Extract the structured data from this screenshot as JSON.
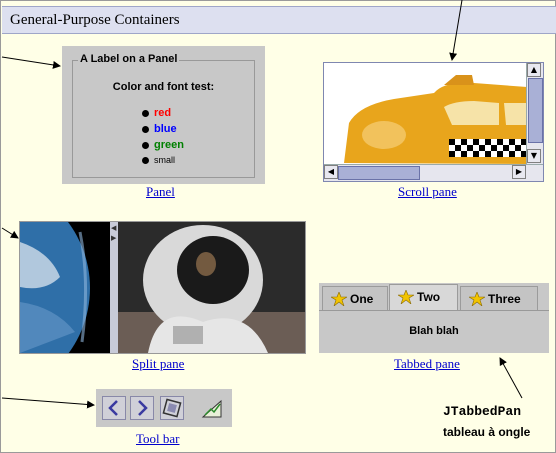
{
  "header": {
    "title": "General-Purpose Containers"
  },
  "panel_demo": {
    "title": "A Label on a Panel",
    "subtitle": "Color and font test:",
    "items": [
      {
        "label": "red",
        "color": "#ff0000"
      },
      {
        "label": "blue",
        "color": "#0000ff"
      },
      {
        "label": "green",
        "color": "#008000"
      },
      {
        "label": "small",
        "color": "#000000"
      }
    ],
    "caption": "Panel"
  },
  "scroll_demo": {
    "caption": "Scroll pane"
  },
  "split_demo": {
    "caption": "Split pane"
  },
  "tabbed_demo": {
    "tabs": [
      {
        "label": "One"
      },
      {
        "label": "Two"
      },
      {
        "label": "Three"
      }
    ],
    "content": "Blah blah",
    "caption": "Tabbed pane"
  },
  "toolbar_demo": {
    "caption": "Tool bar"
  },
  "annotation": {
    "line1": "JTabbedPan",
    "line2": "tableau à ongle"
  }
}
